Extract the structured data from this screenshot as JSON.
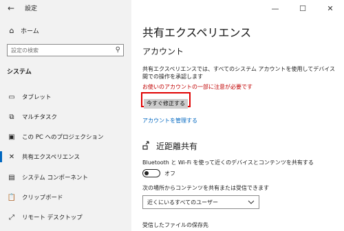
{
  "window": {
    "title": "設定",
    "controls": {
      "minimize": "—",
      "maximize": "☐",
      "close": "✕"
    },
    "back_icon": "←"
  },
  "sidebar": {
    "home": {
      "icon": "home-icon",
      "glyph": "⌂",
      "label": "ホーム"
    },
    "search": {
      "placeholder": "設定の検索",
      "icon": "search-icon",
      "glyph": "⚲"
    },
    "section": "システム",
    "items": [
      {
        "icon": "tablet-icon",
        "glyph": "▭",
        "label": "タブレット",
        "active": false
      },
      {
        "icon": "multitask-icon",
        "glyph": "⧉",
        "label": "マルチタスク",
        "active": false
      },
      {
        "icon": "project-icon",
        "glyph": "▣",
        "label": "この PC へのプロジェクション",
        "active": false
      },
      {
        "icon": "shared-experience-icon",
        "glyph": "✕",
        "label": "共有エクスペリエンス",
        "active": true
      },
      {
        "icon": "components-icon",
        "glyph": "▤",
        "label": "システム コンポーネント",
        "active": false
      },
      {
        "icon": "clipboard-icon",
        "glyph": "📋",
        "label": "クリップボード",
        "active": false
      },
      {
        "icon": "remote-desktop-icon",
        "glyph": "⤢",
        "label": "リモート デスクトップ",
        "active": false
      }
    ]
  },
  "main": {
    "title": "共有エクスペリエンス",
    "account_heading": "アカウント",
    "account_desc": "共有エクスペリエンスでは、すべてのシステム アカウントを使用してデバイス間での操作を承認します",
    "warning": "お使いのアカウントの一部に注意が必要です",
    "fix_button": "今すぐ修正する",
    "manage_link": "アカウントを管理する",
    "nearby_heading": "近距離共有",
    "nearby_icon": "nearby-share-icon",
    "nearby_desc": "Bluetooth と Wi-Fi を使って近くのデバイスとコンテンツを共有する",
    "toggle_label": "オフ",
    "share_from_label": "次の場所からコンテンツを共有または受信できます",
    "share_from_value": "近くにいるすべてのユーザー",
    "save_location_label": "受信したファイルの保存先"
  },
  "colors": {
    "accent": "#0067c0",
    "warning": "#c00000",
    "highlight_border": "#e00000",
    "sidebar_bg": "#f2f2f2"
  }
}
